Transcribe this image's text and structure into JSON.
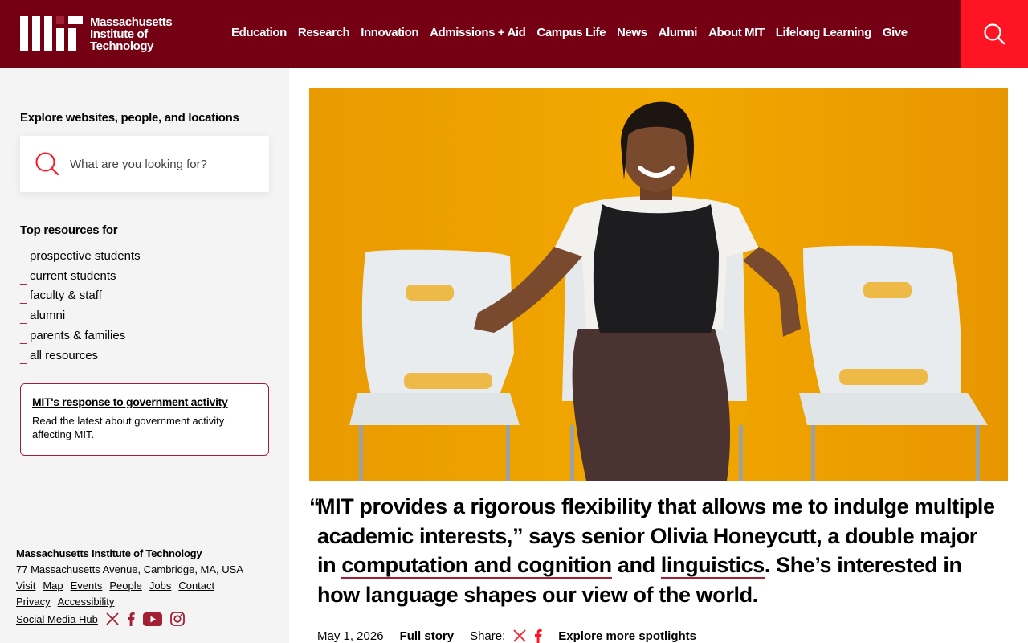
{
  "header": {
    "logo_text": [
      "Massachusetts",
      "Institute of",
      "Technology"
    ],
    "nav": [
      "Education",
      "Research",
      "Innovation",
      "Admissions + Aid",
      "Campus Life",
      "News",
      "Alumni",
      "About MIT",
      "Lifelong Learning",
      "Give"
    ],
    "search_icon": "search-icon"
  },
  "sidebar": {
    "explore_heading": "Explore websites, people, and locations",
    "search_placeholder": "What are you looking for?",
    "top_resources_heading": "Top resources for",
    "resources": [
      "prospective students",
      "current students",
      "faculty & staff",
      "alumni",
      "parents & families",
      "all resources"
    ],
    "notice": {
      "title": "MIT's response to government activity",
      "text": "Read the latest about government activity affecting MIT."
    },
    "footer": {
      "name": "Massachusetts Institute of Technology",
      "address": "77 Massachusetts Avenue, Cambridge, MA, USA",
      "links": [
        "Visit",
        "Map",
        "Events",
        "People",
        "Jobs",
        "Contact"
      ],
      "links2": [
        "Privacy",
        "Accessibility"
      ],
      "social_label": "Social Media Hub",
      "social_icons": [
        "x-icon",
        "facebook-icon",
        "youtube-icon",
        "instagram-icon"
      ]
    }
  },
  "spotlight": {
    "open_quote": "“",
    "text_1": "MIT provides a rigorous flexibility that allows me to indulge multiple academic interests,” says senior Olivia Honeycutt, a double major in ",
    "link_1": "computation and cognition",
    "text_2": " and ",
    "link_2": "linguistics",
    "text_3": ". She’s interested in how language shapes our view of the world.",
    "date": "May 1, 2026",
    "full_story": "Full story",
    "share_label": "Share:",
    "explore_more": "Explore more spotlights"
  },
  "colors": {
    "header_bg": "#750014",
    "search_bg": "#ff1423",
    "accent": "#a31f34",
    "hero_bg": "#f0a500"
  }
}
